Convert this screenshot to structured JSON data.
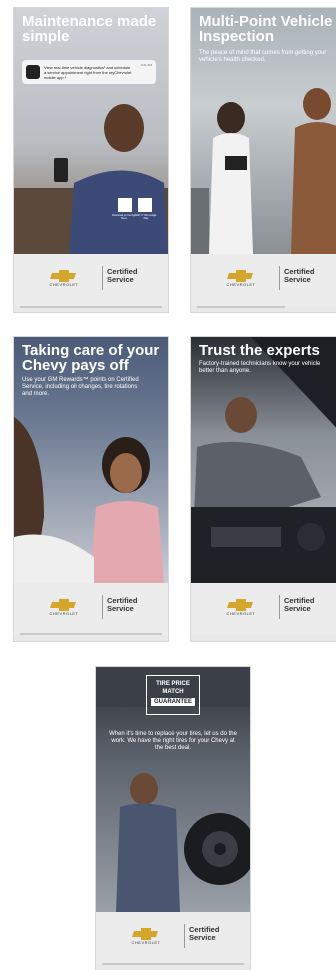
{
  "banners": [
    {
      "title": "Maintenance made simple",
      "notification": "View real-time vehicle diagnostics¹ and schedule a service appointment right from the myChevrolet mobile app.¹",
      "notification_time": "9:41 AM",
      "qr_captions": [
        "Download on the App Store",
        "GET IT ON Google Play"
      ],
      "brand": "CHEVROLET",
      "certified": [
        "Certified",
        "Service"
      ]
    },
    {
      "title": "Multi-Point Vehicle Inspection",
      "subtitle": "The peace of mind that comes from getting your vehicle's health checked.",
      "brand": "CHEVROLET",
      "certified": [
        "Certified",
        "Service"
      ]
    },
    {
      "title": "Taking care of your Chevy pays off",
      "subtitle": "Use your GM Rewards™ points on Certified Service, including oil changes, tire rotations and more.",
      "brand": "CHEVROLET",
      "certified": [
        "Certified",
        "Service"
      ]
    },
    {
      "title": "Trust the experts",
      "subtitle": "Factory-trained technicians know your vehicle better than anyone.",
      "brand": "CHEVROLET",
      "certified": [
        "Certified",
        "Service"
      ]
    },
    {
      "badge": [
        "TIRE PRICE",
        "MATCH",
        "GUARANTEE"
      ],
      "subtitle": "When it's time to replace your tires, let us do the work. We have the right tires for your Chevy at the best deal.",
      "brand": "CHEVROLET",
      "certified": [
        "Certified",
        "Service"
      ]
    }
  ],
  "colors": {
    "bowtie_gold": "#d4a72c",
    "footer_bg": "#ececec",
    "text_dark": "#333333"
  }
}
